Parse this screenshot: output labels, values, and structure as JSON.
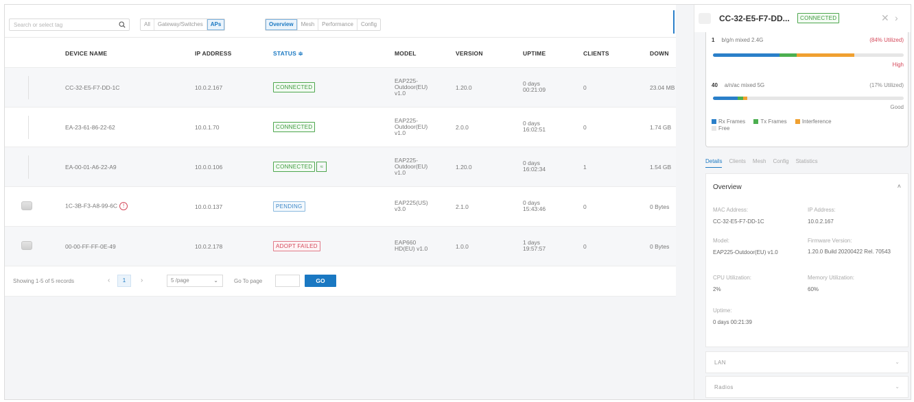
{
  "toolbar": {
    "search_placeholder": "Search or select tag",
    "type_filters": [
      "All",
      "Gateway/Switches",
      "APs"
    ],
    "type_active": 2,
    "view_tabs": [
      "Overview",
      "Mesh",
      "Performance",
      "Config"
    ],
    "view_active": 0
  },
  "table": {
    "headers": {
      "name": "DEVICE NAME",
      "ip": "IP ADDRESS",
      "status": "STATUS ≑",
      "model": "MODEL",
      "version": "VERSION",
      "uptime": "UPTIME",
      "clients": "CLIENTS",
      "down": "DOWN"
    },
    "rows": [
      {
        "name": "CC-32-E5-F7-DD-1C",
        "ip": "10.0.2.167",
        "status": "CONNECTED",
        "model": "EAP225-Outdoor(EU) v1.0",
        "version": "1.20.0",
        "uptime": "0 days 00:21:09",
        "clients": "0",
        "down": "23.04 MB"
      },
      {
        "name": "EA-23-61-86-22-62",
        "ip": "10.0.1.70",
        "status": "CONNECTED",
        "model": "EAP225-Outdoor(EU) v1.0",
        "version": "2.0.0",
        "uptime": "0 days 16:02:51",
        "clients": "0",
        "down": "1.74 GB"
      },
      {
        "name": "EA-00-01-A6-22-A9",
        "ip": "10.0.0.106",
        "status": "CONNECTED",
        "model": "EAP225-Outdoor(EU) v1.0",
        "version": "1.20.0",
        "uptime": "0 days 16:02:34",
        "clients": "1",
        "down": "1.54 GB"
      },
      {
        "name": "1C-3B-F3-A8-99-6C",
        "ip": "10.0.0.137",
        "status": "PENDING",
        "model": "EAP225(US) v3.0",
        "version": "2.1.0",
        "uptime": "0 days 15:43:46",
        "clients": "0",
        "down": "0 Bytes"
      },
      {
        "name": "00-00-FF-FF-0E-49",
        "ip": "10.0.2.178",
        "status": "ADOPT FAILED",
        "model": "EAP660 HD(EU) v1.0",
        "version": "1.0.0",
        "uptime": "1 days 19:57:57",
        "clients": "0",
        "down": "0 Bytes"
      }
    ]
  },
  "pager": {
    "showing": "Showing 1-5 of 5 records",
    "current_page": "1",
    "per_page": "5 /page",
    "goto_label": "Go To page",
    "go_button": "GO"
  },
  "panel": {
    "title": "CC-32-E5-F7-DD...",
    "status": "CONNECTED",
    "radio1": {
      "count": "1",
      "label": "b/g/n mixed 2.4G",
      "util": "(84% Utilized)",
      "quality": "High",
      "rx": 0.35,
      "tx": 0.09,
      "intf": 0.3
    },
    "radio2": {
      "count": "40",
      "label": "a/n/ac mixed 5G",
      "util": "(17% Utilized)",
      "quality": "Good",
      "rx": 0.13,
      "tx": 0.03,
      "intf": 0.02
    },
    "legend": [
      "Rx Frames",
      "Tx Frames",
      "Interference",
      "Free"
    ],
    "tabs": [
      "Details",
      "Clients",
      "Mesh",
      "Config",
      "Statistics"
    ],
    "overview_title": "Overview",
    "fields": {
      "mac_label": "MAC Address:",
      "mac": "CC-32-E5-F7-DD-1C",
      "ip_label": "IP Address:",
      "ip": "10.0.2.167",
      "model_label": "Model:",
      "model": "EAP225-Outdoor(EU) v1.0",
      "fw_label": "Firmware Version:",
      "fw": "1.20.0 Build 20200422 Rel. 70543",
      "cpu_label": "CPU Utilization:",
      "cpu": "2%",
      "mem_label": "Memory Utilization:",
      "mem": "60%",
      "up_label": "Uptime:",
      "up": "0 days 00:21:39"
    },
    "lan": "LAN",
    "radios": "Radios"
  },
  "colors": {
    "accent": "#1a78c2",
    "rx": "#2a7fc9",
    "tx": "#4caf50",
    "intf": "#f0a030",
    "free": "#e6e6e6"
  }
}
